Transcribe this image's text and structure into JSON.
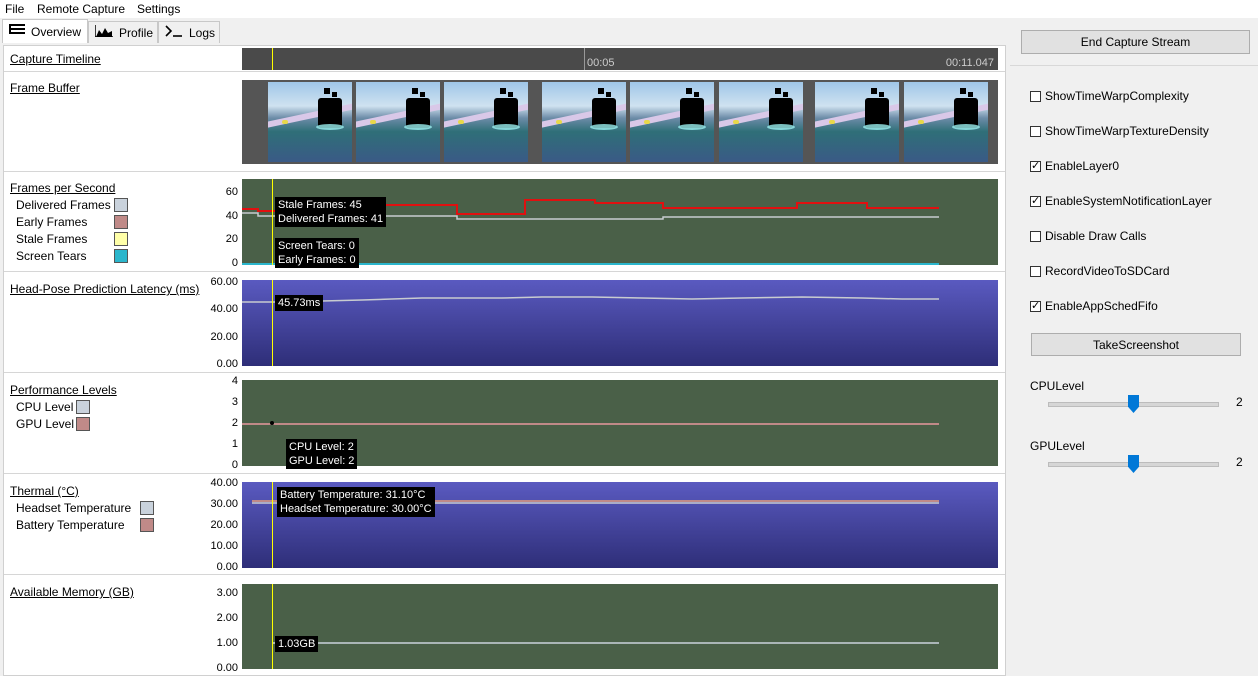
{
  "menu": [
    "File",
    "Remote Capture",
    "Settings"
  ],
  "tabs": [
    {
      "label": "Overview",
      "icon": "list-icon"
    },
    {
      "label": "Profile",
      "icon": "chart-icon"
    },
    {
      "label": "Logs",
      "icon": "terminal-icon"
    }
  ],
  "timeline": {
    "title": "Capture Timeline",
    "mark_mid": "00:05",
    "mark_end": "00:11.047"
  },
  "frame_buffer": {
    "title": "Frame Buffer",
    "thumbnail_count": 8
  },
  "fps": {
    "title": "Frames per Second",
    "legend": [
      {
        "label": "Delivered Frames",
        "color": "#c9d2dc"
      },
      {
        "label": "Early Frames",
        "color": "#c08a88"
      },
      {
        "label": "Stale Frames",
        "color": "#ffffa8"
      },
      {
        "label": "Screen Tears",
        "color": "#2bb6cc"
      }
    ],
    "yticks": [
      "60",
      "40",
      "20",
      "0"
    ],
    "tooltip_top": [
      "Stale Frames: 45",
      "Delivered Frames: 41"
    ],
    "tooltip_bottom": [
      "Screen Tears: 0",
      "Early Frames: 0"
    ]
  },
  "latency": {
    "title": "Head-Pose Prediction Latency (ms)",
    "yticks": [
      "60.00",
      "40.00",
      "20.00",
      "0.00"
    ],
    "tooltip": "45.73ms"
  },
  "perf": {
    "title": "Performance Levels",
    "legend": [
      {
        "label": "CPU Level",
        "color": "#c9d2dc"
      },
      {
        "label": "GPU Level",
        "color": "#c08a88"
      }
    ],
    "yticks": [
      "4",
      "3",
      "2",
      "1",
      "0"
    ],
    "tooltip": [
      "CPU Level: 2",
      "GPU Level: 2"
    ]
  },
  "thermal": {
    "title": "Thermal (°C)",
    "legend": [
      {
        "label": "Headset Temperature",
        "color": "#c9d2dc"
      },
      {
        "label": "Battery Temperature",
        "color": "#c08a88"
      }
    ],
    "yticks": [
      "40.00",
      "30.00",
      "20.00",
      "10.00",
      "0.00"
    ],
    "tooltip": [
      "Battery Temperature: 31.10°C",
      "Headset Temperature: 30.00°C"
    ]
  },
  "memory": {
    "title": "Available Memory (GB)",
    "yticks": [
      "3.00",
      "2.00",
      "1.00",
      "0.00"
    ],
    "tooltip": "1.03GB"
  },
  "right": {
    "end_button": "End Capture Stream",
    "checkboxes": [
      {
        "label": "ShowTimeWarpComplexity",
        "checked": false
      },
      {
        "label": "ShowTimeWarpTextureDensity",
        "checked": false
      },
      {
        "label": "EnableLayer0",
        "checked": true
      },
      {
        "label": "EnableSystemNotificationLayer",
        "checked": true
      },
      {
        "label": "Disable Draw Calls",
        "checked": false
      },
      {
        "label": "RecordVideoToSDCard",
        "checked": false
      },
      {
        "label": "EnableAppSchedFifo",
        "checked": true
      }
    ],
    "screenshot_button": "TakeScreenshot",
    "cpu_label": "CPULevel",
    "cpu_value": "2",
    "gpu_label": "GPULevel",
    "gpu_value": "2"
  },
  "colors": {
    "green_chart": "#4a6048",
    "blue_chart": "#4a4aa8",
    "red_line": "#e01010",
    "white_line": "#c8ccd0",
    "cursor": "#ffff00",
    "thumb": "#0078d7"
  }
}
